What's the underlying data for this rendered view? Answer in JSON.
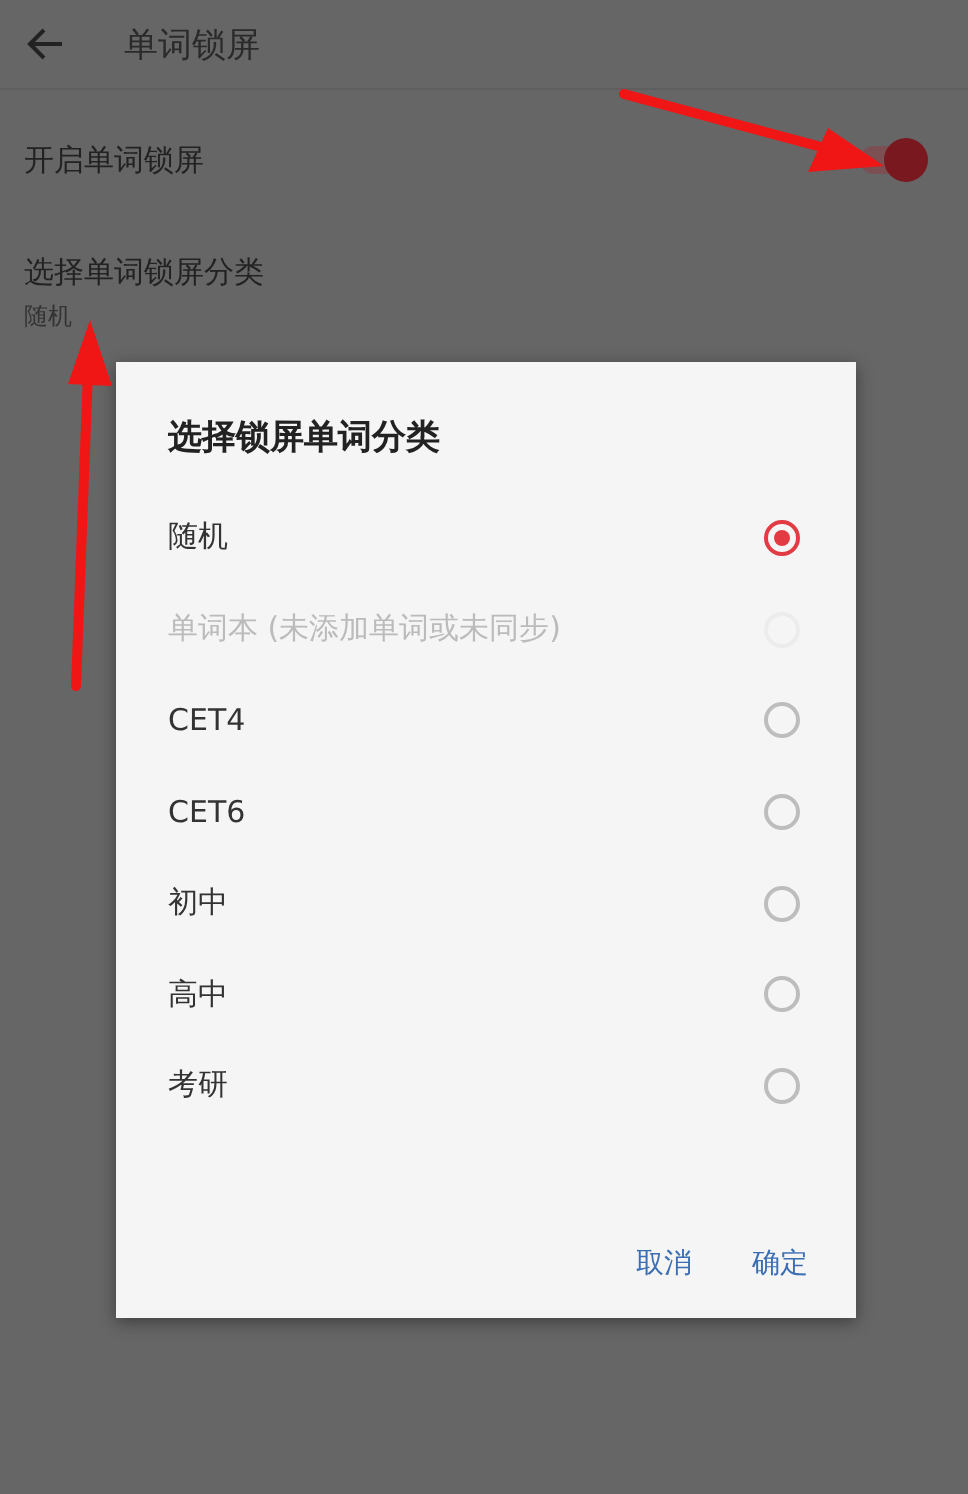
{
  "app_bar": {
    "title": "单词锁屏"
  },
  "settings": [
    {
      "kind": "switch",
      "title": "开启单词锁屏",
      "on": true
    },
    {
      "kind": "choice",
      "title": "选择单词锁屏分类",
      "summary": "随机"
    }
  ],
  "dialog": {
    "title": "选择锁屏单词分类",
    "options": [
      {
        "label": "随机",
        "selected": true,
        "disabled": false
      },
      {
        "label": "单词本 (未添加单词或未同步)",
        "selected": false,
        "disabled": true
      },
      {
        "label": "CET4",
        "selected": false,
        "disabled": false
      },
      {
        "label": "CET6",
        "selected": false,
        "disabled": false
      },
      {
        "label": "初中",
        "selected": false,
        "disabled": false
      },
      {
        "label": "高中",
        "selected": false,
        "disabled": false
      },
      {
        "label": "考研",
        "selected": false,
        "disabled": false
      }
    ],
    "buttons": [
      "取消",
      "确定"
    ]
  }
}
